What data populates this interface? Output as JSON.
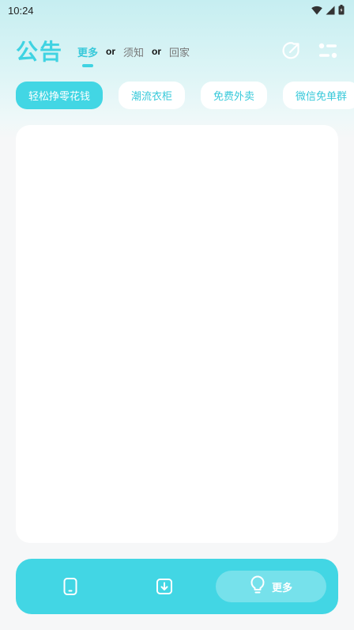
{
  "status_bar": {
    "time": "10:24"
  },
  "header": {
    "title": "公告",
    "tabs": [
      {
        "label": "更多",
        "active": true
      },
      {
        "label": "须知",
        "active": false
      },
      {
        "label": "回家",
        "active": false
      }
    ],
    "separator": "or"
  },
  "chips": [
    {
      "label": "轻松挣零花钱",
      "active": true
    },
    {
      "label": "潮流衣柜",
      "active": false
    },
    {
      "label": "免费外卖",
      "active": false
    },
    {
      "label": "微信免单群",
      "active": false
    }
  ],
  "bottom_nav": {
    "more_label": "更多"
  },
  "colors": {
    "accent": "#42d6e4",
    "accent_text": "#38c9da",
    "background": "#f6f7f8"
  }
}
